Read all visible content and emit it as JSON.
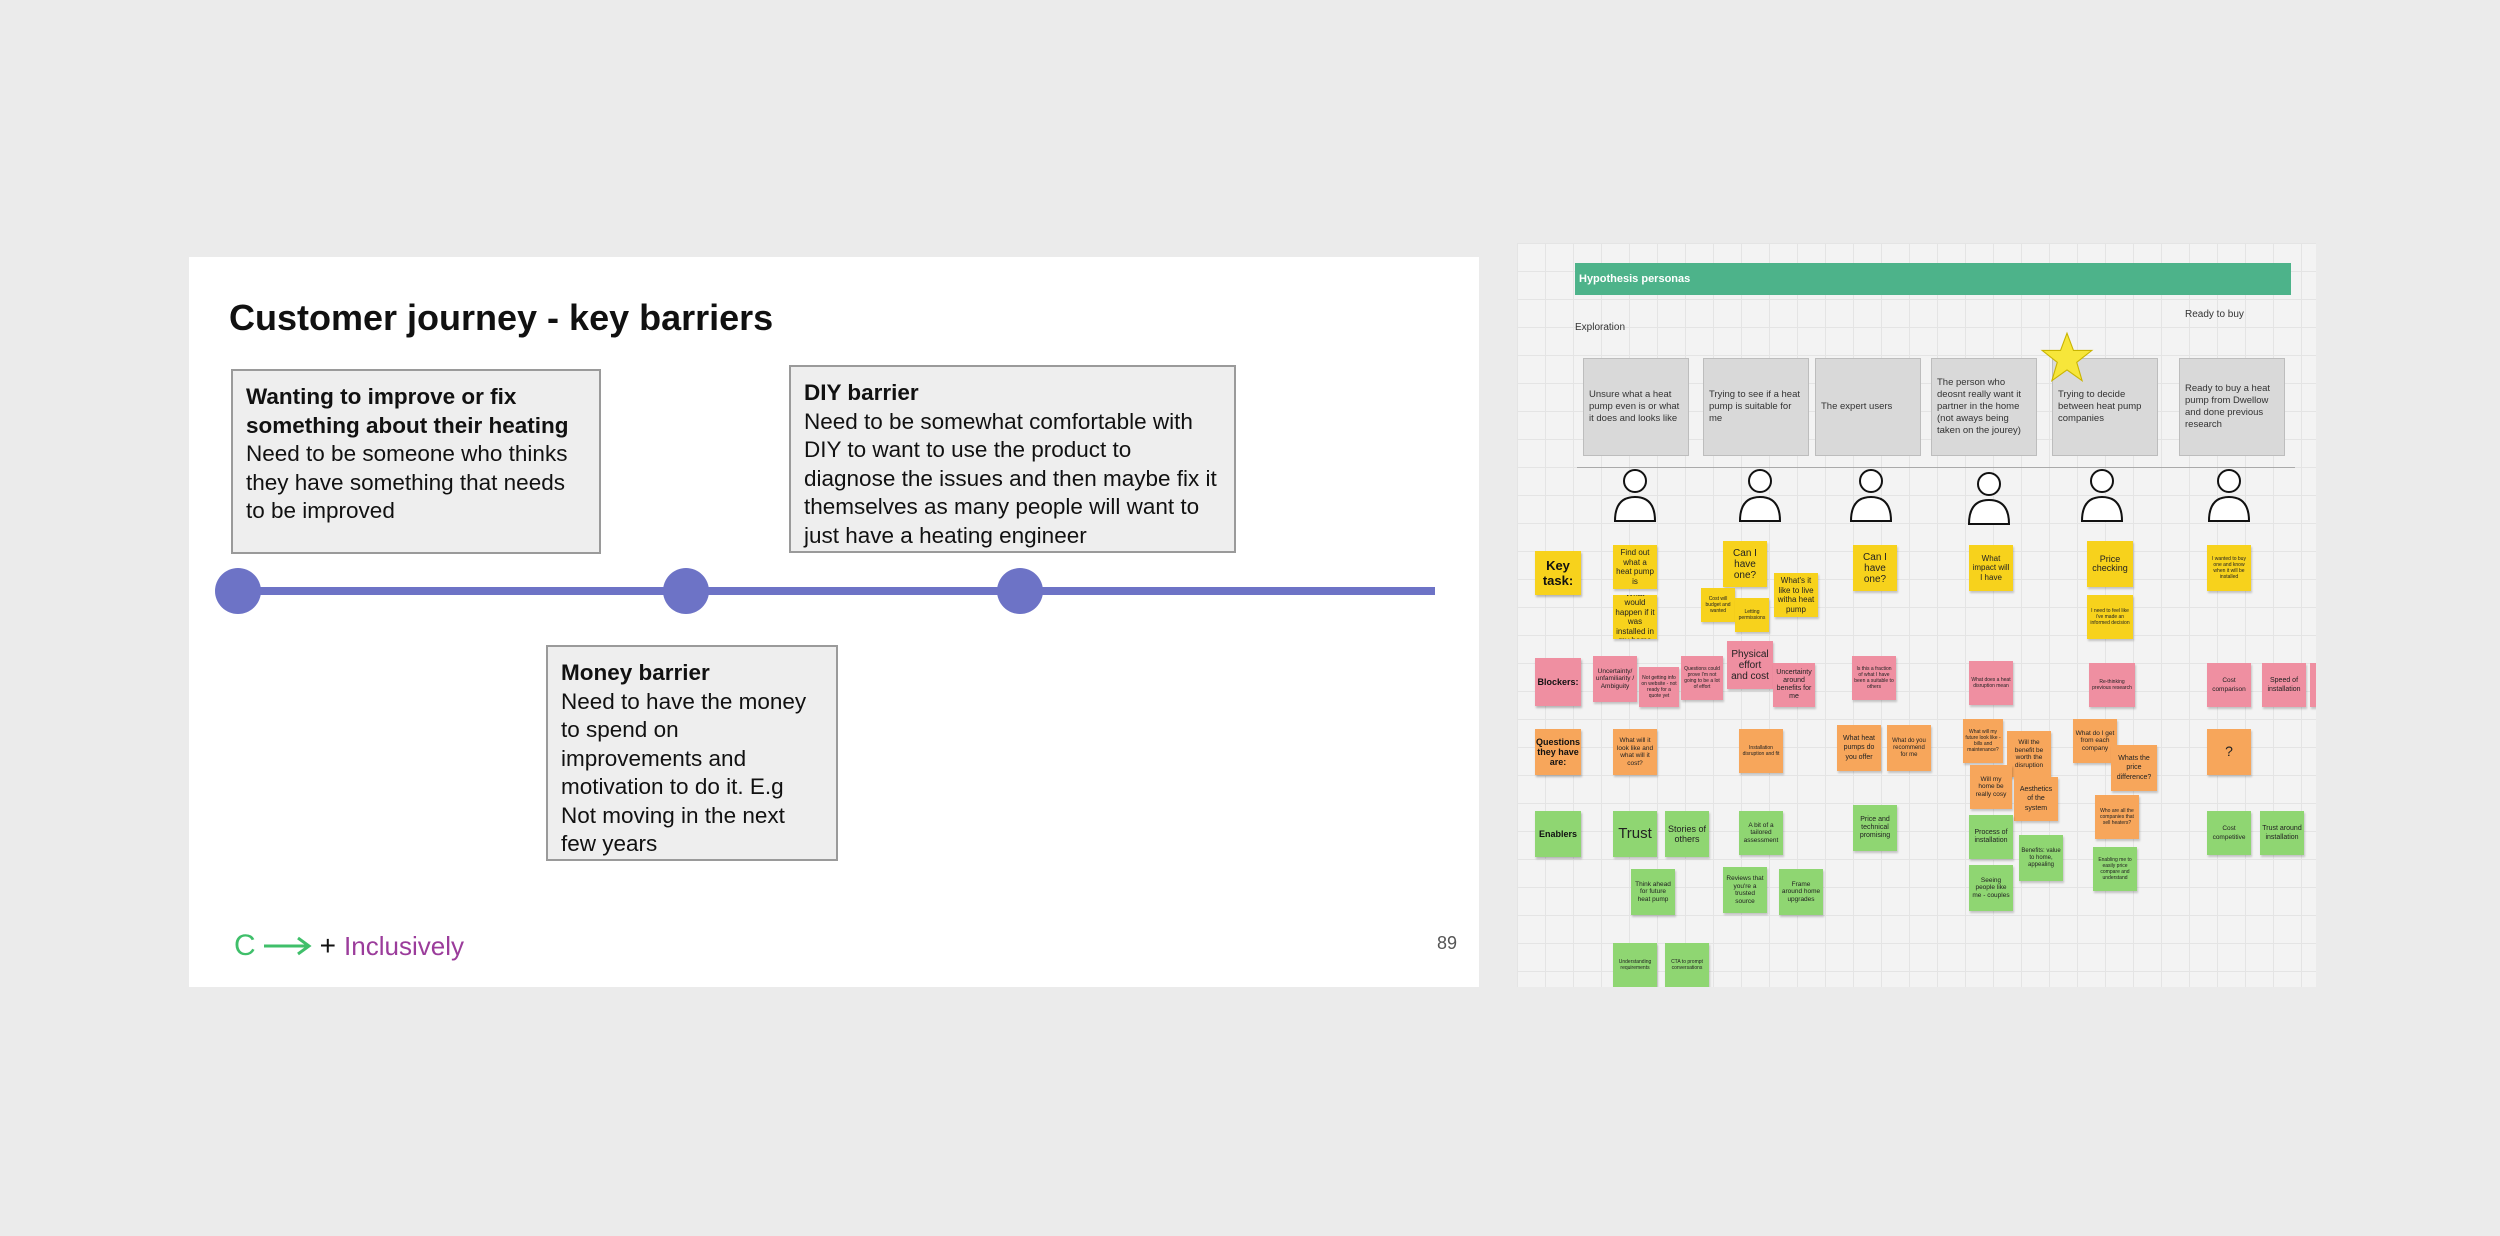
{
  "slide": {
    "title": "Customer journey - key barriers",
    "boxes": [
      {
        "title": "Wanting to improve or fix something about their heating",
        "body": "Need to be someone who thinks they have something that needs to be improved"
      },
      {
        "title": "DIY barrier",
        "body": "Need to be somewhat comfortable with DIY to want to use the product to diagnose the issues and then maybe fix it themselves as many people will want to just have a heating engineer"
      },
      {
        "title": "Money barrier",
        "body": "Need to have the money to spend on improvements and motivation to do it. E.g Not moving in the next few years"
      }
    ],
    "logo": {
      "c": "C",
      "plus": "+",
      "text": "Inclusively"
    },
    "page_number": "89",
    "colors": {
      "timeline": "#6d73c6",
      "logo_green": "#3fbf6a",
      "logo_purple": "#9b3c9b"
    }
  },
  "board": {
    "header": "Hypothesis personas",
    "exploration_label": "Exploration",
    "ready_label": "Ready to buy",
    "personas": [
      "Unsure what a heat pump even is or what it does and looks like",
      "Trying to see if a heat pump is suitable for me",
      "The expert users",
      "The  person who deosnt really want it partner in the home (not aways being taken on the jourey)",
      "Trying to decide between heat pump companies",
      "Ready to buy a heat pump from Dwellow and done previous research"
    ],
    "row_labels": {
      "key_task": "Key task:",
      "blockers": "Blockers:",
      "questions": "Questions they have are:",
      "enablers": "Enablers"
    },
    "stickies": {
      "s1": "Find out what a heat pump is",
      "s2": "What would happen if it was installed in my home",
      "s3": "Can I have one?",
      "s4": "Cost will budget and wanted",
      "s5": "Letting permissions",
      "s6": "What's it like to live witha heat pump",
      "s7": "Can I have one?",
      "s8": "What impact will I have",
      "s9": "Price checking",
      "s10": "I need to feel like i've made an informed decision",
      "s11": "I wanted to buy one and know when it will be installed",
      "b1": "Uncertainty/ unfamiliarity / Ambiguity",
      "b2": "Not getting info on website - not ready for a quote yet",
      "b3": "Questions could prove I'm not going to be a lot of effort",
      "b4": "Physical effort and cost",
      "b5": "Uncertainty around benefits for me",
      "b6": "Is this a fraction of what I have been a suitable to others",
      "b7": "What does a heat disruption mean",
      "b8": "Re-thinking previous research",
      "b9": "Cost comparison",
      "b10": "Speed of installation",
      "q1": "What will it look like and what will it cost?",
      "q2": "Installation disruption and fit",
      "q3": "What heat pumps do you offer",
      "q4": "What do you recommend for me",
      "q5": "What will my future look like - bills and maintenance?",
      "q6": "Will the benefit be worth the disruption",
      "q7": "What do I get from each company",
      "q8": "Will my home be really cosy",
      "q9": "Aesthetics of the system",
      "q10": "Whats the price difference?",
      "q11": "Who are all the companies that sell heaters?",
      "q12": "?",
      "e1": "Trust",
      "e2": "Stories of others",
      "e3": "A bit of a tailored assessment",
      "e4": "Price and technical promising",
      "e5": "Process of installation",
      "e6": "Benefits: value to home, appealing",
      "e7": "Enabling me to easily price compare and understand",
      "e8": "Cost competitive",
      "e9": "Trust around installation",
      "e10": "Think ahead for future heat pump",
      "e11": "Reviews that you're a trusted source",
      "e12": "Frame around home upgrades",
      "e13": "Seeing people like me - couples",
      "e14": "Understanding requirements",
      "e15": "CTA to prompt conversations"
    },
    "colors": {
      "header": "#4db38a",
      "yellow": "#f7d21c",
      "pink": "#ef8fa1",
      "orange": "#f7a65b",
      "green": "#8fd672"
    }
  }
}
